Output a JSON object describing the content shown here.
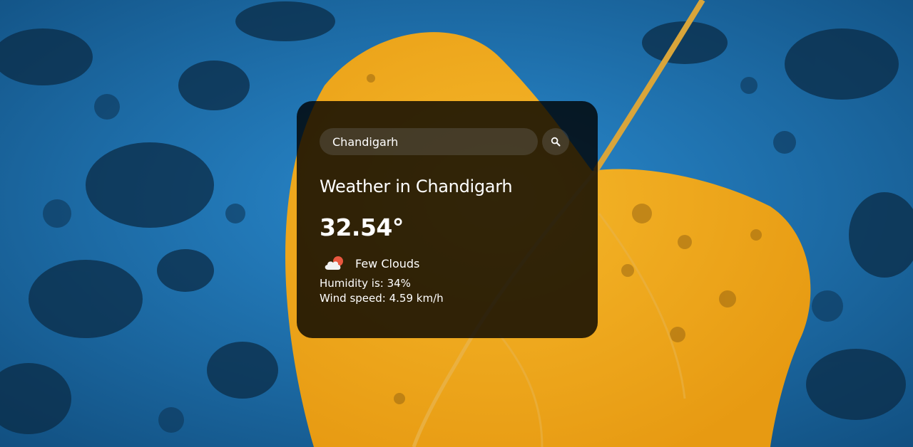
{
  "search": {
    "value": "Chandigarh",
    "placeholder": "Search"
  },
  "weather": {
    "title": "Weather in Chandigarh",
    "temperature": "32.54°",
    "description": "Few Clouds",
    "humidity": "Humidity is: 34%",
    "wind": "Wind speed: 4.59 km/h",
    "icon": "few-clouds-icon"
  },
  "colors": {
    "background": "#1f76b0",
    "leaf": "#f0a91c",
    "card": "rgba(0,0,0,0.8)",
    "text": "#ffffff"
  }
}
